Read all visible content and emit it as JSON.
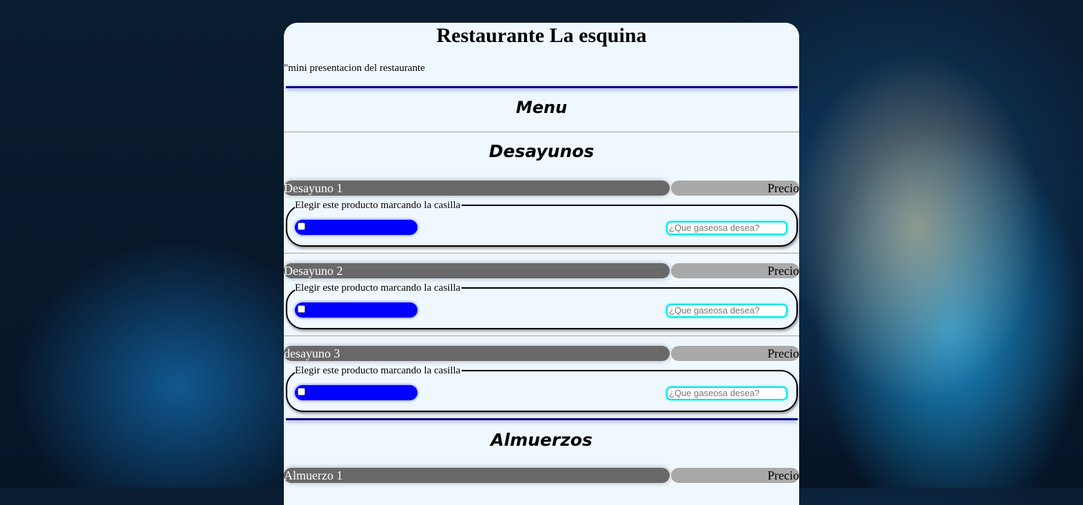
{
  "header": {
    "title": "Restaurante La esquina",
    "intro": "\"mini presentacion del restaurante"
  },
  "menu_title": "Menu",
  "sections": [
    {
      "title": "Desayunos",
      "items": [
        {
          "name": "Desayuno 1",
          "price": "Precio",
          "legend": "Elegir este producto marcando la casilla",
          "placeholder": "¿Que gaseosa desea?"
        },
        {
          "name": "Desayuno 2",
          "price": "Precio",
          "legend": "Elegir este producto marcando la casilla",
          "placeholder": "¿Que gaseosa desea?"
        },
        {
          "name": "desayuno 3",
          "price": "Precio",
          "legend": "Elegir este producto marcando la casilla",
          "placeholder": "¿Que gaseosa desea?"
        }
      ]
    },
    {
      "title": "Almuerzos",
      "items": [
        {
          "name": "Almuerzo 1",
          "price": "Precio"
        }
      ]
    }
  ]
}
